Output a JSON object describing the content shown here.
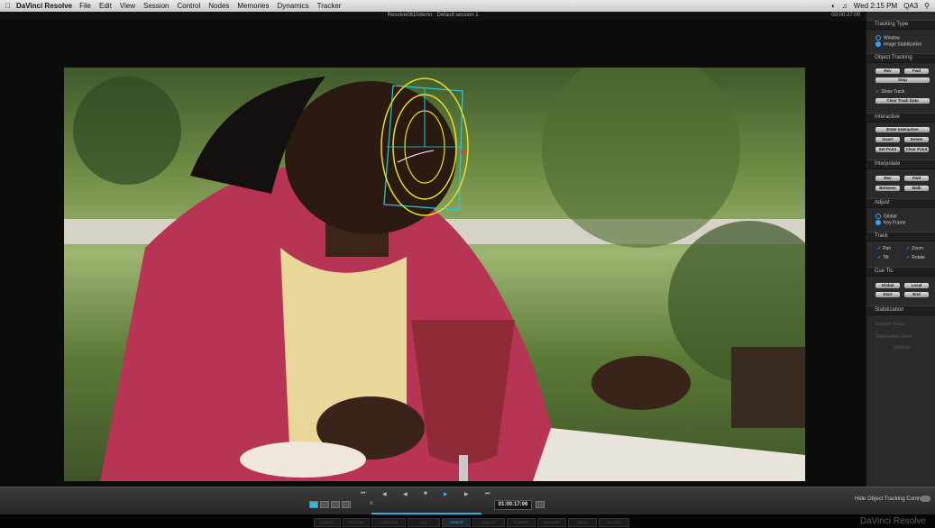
{
  "menubar": {
    "app": "DaVinci Resolve",
    "items": [
      "File",
      "Edit",
      "View",
      "Session",
      "Control",
      "Nodes",
      "Memories",
      "Dynamics",
      "Tracker"
    ],
    "clock": "Wed 2:15 PM",
    "user": "QA3"
  },
  "window": {
    "title": "Resolve0810demo : Default session 1",
    "timecode": "00:00:27:00"
  },
  "panel": {
    "tracking_type": {
      "header": "Tracking Type",
      "options": [
        "Window",
        "Image Stabilization"
      ]
    },
    "object_tracking": {
      "header": "Object Tracking",
      "rev": "Rev",
      "fwd": "Fwd",
      "stop": "Stop",
      "show_track": "Show Track",
      "clear": "Clear Track Data"
    },
    "interactive": {
      "header": "Interactive",
      "enter": "Enter Interactive",
      "insert": "Insert",
      "delete": "Delete",
      "set_point": "Set Point",
      "clear_point": "Clear Point"
    },
    "interpolate": {
      "header": "Interpolate",
      "rev": "Rev",
      "fwd": "Fwd",
      "between": "Between",
      "walk": "Walk"
    },
    "adjust": {
      "header": "Adjust",
      "options": [
        "Global",
        "Key Frame"
      ]
    },
    "track": {
      "header": "Track",
      "pan": "Pan",
      "zoom": "Zoom",
      "tilt": "Tilt",
      "rotate": "Rotate"
    },
    "cue_tic": {
      "header": "Cue Tic",
      "global": "Global",
      "local": "Local",
      "start": "Start",
      "end": "End"
    },
    "stabilization": {
      "header": "Stabilization",
      "dim1": "Smooth Factor",
      "dim2": "Stabilization Zoom",
      "dim3": "Stabilize"
    }
  },
  "transport": {
    "timecode": "01:00:17:06",
    "hide_label": "Hide Object Tracking Controls",
    "progress_fraction": 0.5
  },
  "pages": [
    "CONFIG",
    "BROWSE",
    "CONFORM",
    "CUT",
    "VIEWER",
    "COLOR",
    "FORMAT",
    "GALLERY",
    "DECK",
    "OUTPUT"
  ],
  "active_page": "VIEWER",
  "brand": "DaVinci Resolve",
  "colors": {
    "accent": "#2ab8ee",
    "tracker_yellow": "#e8e020",
    "tracker_cyan": "#22d0d8",
    "coat": "#c8385a"
  }
}
